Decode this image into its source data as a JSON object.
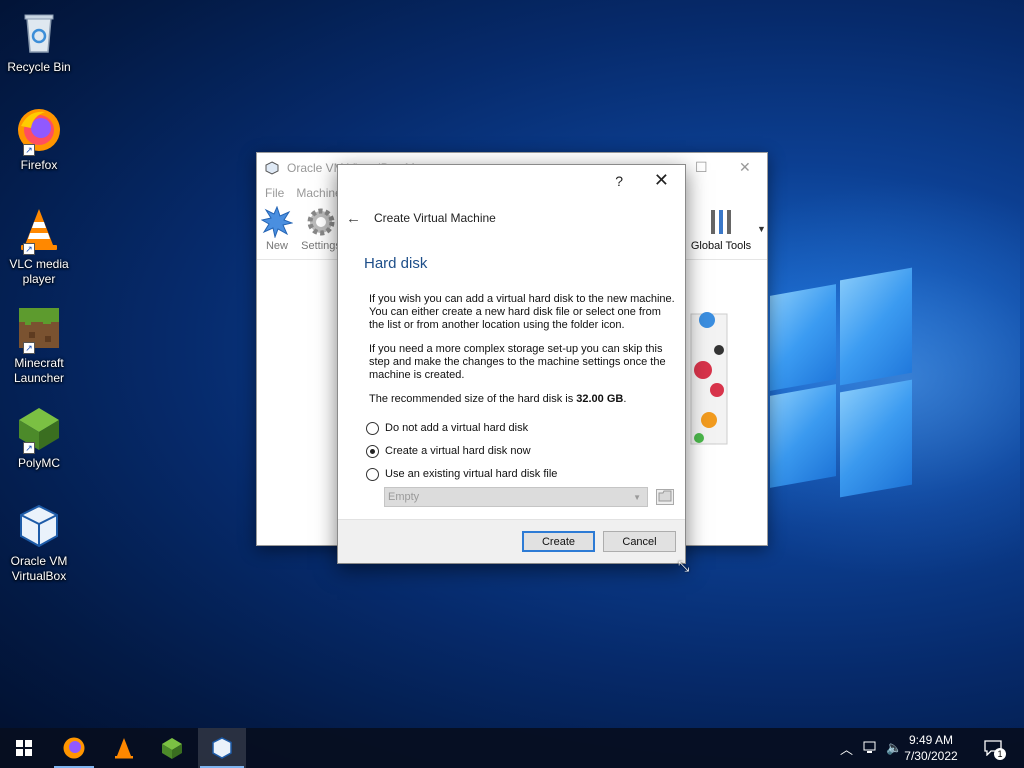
{
  "desktop": {
    "icons": [
      {
        "label": "Recycle Bin"
      },
      {
        "label": "Firefox"
      },
      {
        "label": "VLC media player"
      },
      {
        "label": "Minecraft Launcher"
      },
      {
        "label": "PolyMC"
      },
      {
        "label": "Oracle VM VirtualBox"
      }
    ]
  },
  "vbox": {
    "title": "Oracle VM VirtualBox M",
    "menu": [
      "File",
      "Machine"
    ],
    "toolbar": {
      "new": "New",
      "settings": "Settings",
      "global_tools": "Global Tools"
    }
  },
  "dialog": {
    "help": "?",
    "close": "✕",
    "header_title": "Create Virtual Machine",
    "section_title": "Hard disk",
    "para1": "If you wish you can add a virtual hard disk to the new machine. You can either create a new hard disk file or select one from the list or from another location using the folder icon.",
    "para2": "If you need a more complex storage set-up you can skip this step and make the changes to the machine settings once the machine is created.",
    "recommended_prefix": "The recommended size of the hard disk is ",
    "recommended_size": "32.00 GB",
    "recommended_suffix": ".",
    "options": [
      {
        "label": "Do not add a virtual hard disk",
        "selected": false
      },
      {
        "label": "Create a virtual hard disk now",
        "selected": true
      },
      {
        "label": "Use an existing virtual hard disk file",
        "selected": false
      }
    ],
    "disk_combo_value": "Empty",
    "create_button": "Create",
    "cancel_button": "Cancel"
  },
  "taskbar": {
    "time": "9:49 AM",
    "date": "7/30/2022",
    "notification_count": "1"
  },
  "colors": {
    "accent": "#1d4e89",
    "primary_border": "#2d7bd5"
  }
}
